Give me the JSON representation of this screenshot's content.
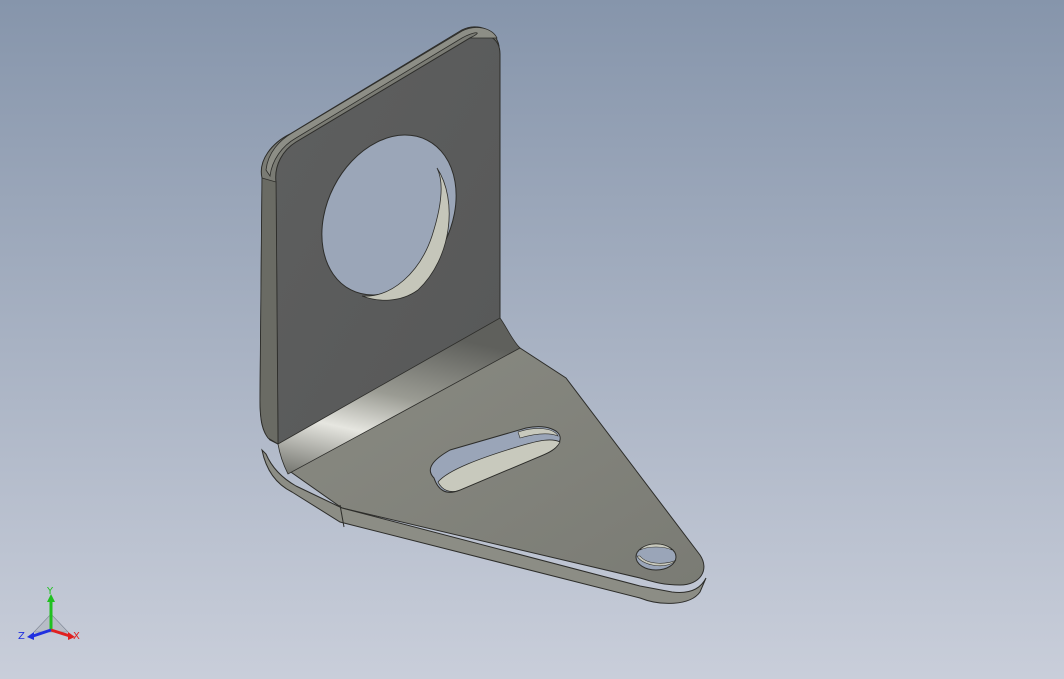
{
  "viewport": {
    "background_top": "#8695ab",
    "background_bottom": "#c9ceda"
  },
  "model": {
    "part": "l-bracket-with-round-hole-and-slot",
    "face_color_dark": "#5b5c5c",
    "face_color_light": "#81827a",
    "edge_color": "#2d2d2a"
  },
  "triad": {
    "x_label": "X",
    "y_label": "Y",
    "z_label": "Z",
    "x_color": "#e02020",
    "y_color": "#20c020",
    "z_color": "#2030e0"
  }
}
